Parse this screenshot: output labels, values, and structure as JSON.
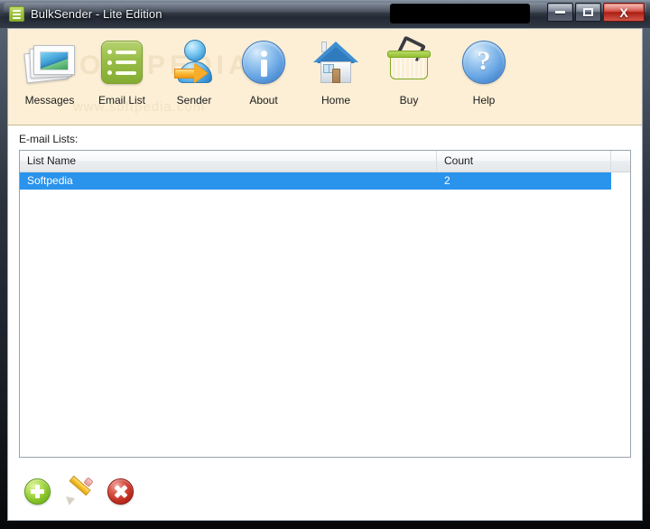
{
  "window": {
    "title": "BulkSender - Lite Edition",
    "app_icon": "list-icon",
    "redacted_title_region": "",
    "controls": {
      "minimize": "–",
      "maximize": "☐",
      "close": "X"
    }
  },
  "watermark": {
    "line1": "SOFTPEDIA",
    "line2": "www.softpedia.com"
  },
  "toolbar": {
    "items": [
      {
        "label": "Messages",
        "icon": "envelopes-icon"
      },
      {
        "label": "Email List",
        "icon": "list-icon"
      },
      {
        "label": "Sender",
        "icon": "user-arrow-icon"
      },
      {
        "label": "About",
        "icon": "info-circle-icon"
      },
      {
        "label": "Home",
        "icon": "house-icon"
      },
      {
        "label": "Buy",
        "icon": "shopping-basket-icon"
      },
      {
        "label": "Help",
        "icon": "question-circle-icon"
      }
    ]
  },
  "main": {
    "lists_label": "E-mail Lists:",
    "columns": [
      "List Name",
      "Count",
      ""
    ],
    "rows": [
      {
        "name": "Softpedia",
        "count": "2",
        "extra": "",
        "selected": true
      }
    ]
  },
  "actions": [
    {
      "label": "Add",
      "icon": "plus-circle-icon"
    },
    {
      "label": "Edit",
      "icon": "pencil-icon"
    },
    {
      "label": "Delete",
      "icon": "delete-circle-icon"
    }
  ],
  "colors": {
    "toolbar_bg": "#fcefd6",
    "selection": "#2a93ec",
    "title_dark": "#39414e",
    "close_red": "#cf4034",
    "accent_green": "#8cbb2a"
  }
}
